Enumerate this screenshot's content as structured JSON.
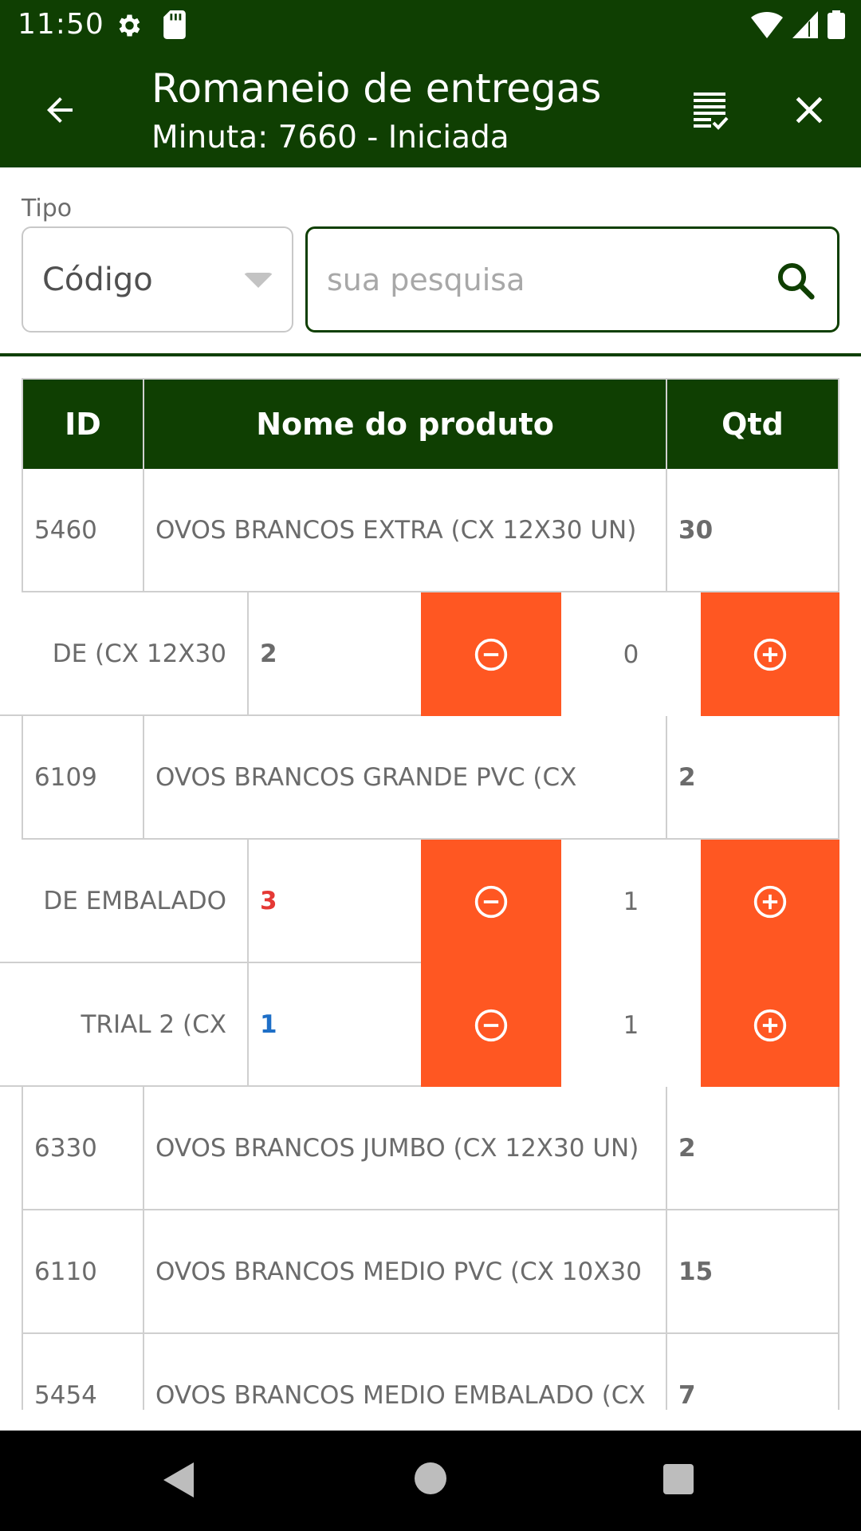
{
  "status_bar": {
    "time": "11:50"
  },
  "app_bar": {
    "title": "Romaneio de entregas",
    "subtitle": "Minuta: 7660 - Iniciada"
  },
  "filter": {
    "type_label": "Tipo",
    "type_value": "Código",
    "search_placeholder": "sua pesquisa",
    "search_value": ""
  },
  "table": {
    "headers": {
      "id": "ID",
      "name": "Nome do produto",
      "qtd": "Qtd"
    },
    "rows": [
      {
        "kind": "item",
        "id": "5460",
        "name": "OVOS BRANCOS EXTRA  (CX 12X30 UN)",
        "qtd": "30"
      },
      {
        "kind": "swiped",
        "name_tail": "DE  (CX  12X30",
        "qtd": "2",
        "count": "0"
      },
      {
        "kind": "item",
        "id": "6109",
        "name": "OVOS BRANCOS GRANDE  PVC (CX",
        "qtd": "2"
      },
      {
        "kind": "swiped",
        "name_tail": "DE EMBALADO",
        "qtd": "3",
        "count": "1"
      },
      {
        "kind": "swiped",
        "name_tail": "TRIAL 2 (CX",
        "qtd": "1",
        "count": "1"
      },
      {
        "kind": "item",
        "id": "6330",
        "name": "OVOS BRANCOS JUMBO  (CX 12X30 UN)",
        "qtd": "2"
      },
      {
        "kind": "item",
        "id": "6110",
        "name": "OVOS BRANCOS MEDIO  PVC (CX  10X30",
        "qtd": "15"
      },
      {
        "kind": "item",
        "id": "5454",
        "name": "OVOS BRANCOS MEDIO EMBALADO (CX",
        "qtd": "7"
      }
    ]
  },
  "colors": {
    "primary": "#0f3f02",
    "accent": "#ff5722",
    "qty_red": "#e53935",
    "qty_blue": "#1e6fc7",
    "text_gray": "#6b6b6b"
  },
  "icons": {
    "back": "arrow-left-icon",
    "checklist": "checklist-icon",
    "close": "close-icon",
    "search": "search-icon",
    "minus": "minus-circle-icon",
    "plus": "plus-circle-icon"
  }
}
